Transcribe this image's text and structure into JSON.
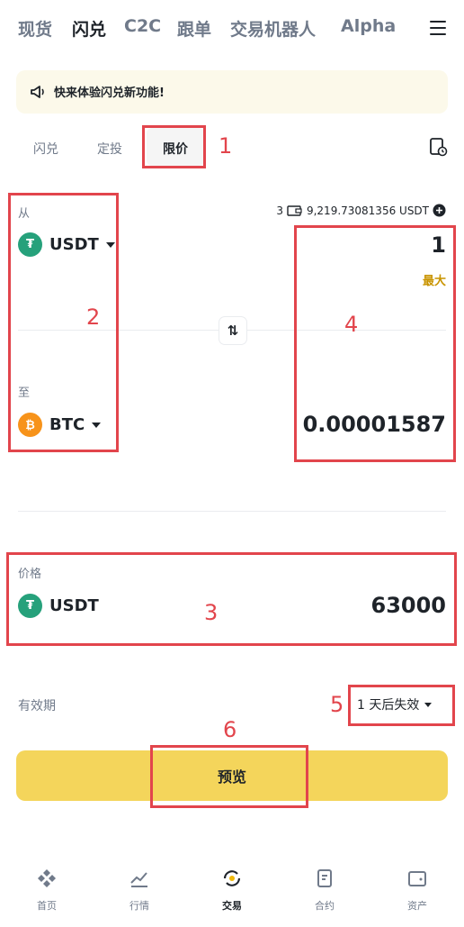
{
  "top_nav": {
    "tabs": [
      "现货",
      "闪兑",
      "C2C",
      "跟单",
      "交易机器人",
      "Alpha"
    ],
    "active": "闪兑"
  },
  "announcement": {
    "text": "快来体验闪兑新功能!"
  },
  "mode_tabs": {
    "items": [
      "闪兑",
      "定投",
      "限价"
    ],
    "active": "限价"
  },
  "from": {
    "label": "从",
    "coin": "USDT",
    "balance_badge": "3",
    "balance": "9,219.73081356 USDT",
    "amount": "1",
    "max_label": "最大"
  },
  "to": {
    "label": "至",
    "coin": "BTC",
    "amount": "0.00001587"
  },
  "price": {
    "label": "价格",
    "coin": "USDT",
    "value": "63000"
  },
  "expiry": {
    "label": "有效期",
    "value": "1 天后失效"
  },
  "preview_button": "预览",
  "annotations": [
    "1",
    "2",
    "3",
    "4",
    "5",
    "6"
  ],
  "bottom_nav": {
    "items": [
      "首页",
      "行情",
      "交易",
      "合约",
      "资产"
    ],
    "active": "交易"
  },
  "colors": {
    "accent": "#f4d55b",
    "max_link": "#c99400",
    "usdt": "#26a17b",
    "btc": "#f7931a",
    "annotation": "#e2454c",
    "announce_bg": "#fcf9ea"
  }
}
